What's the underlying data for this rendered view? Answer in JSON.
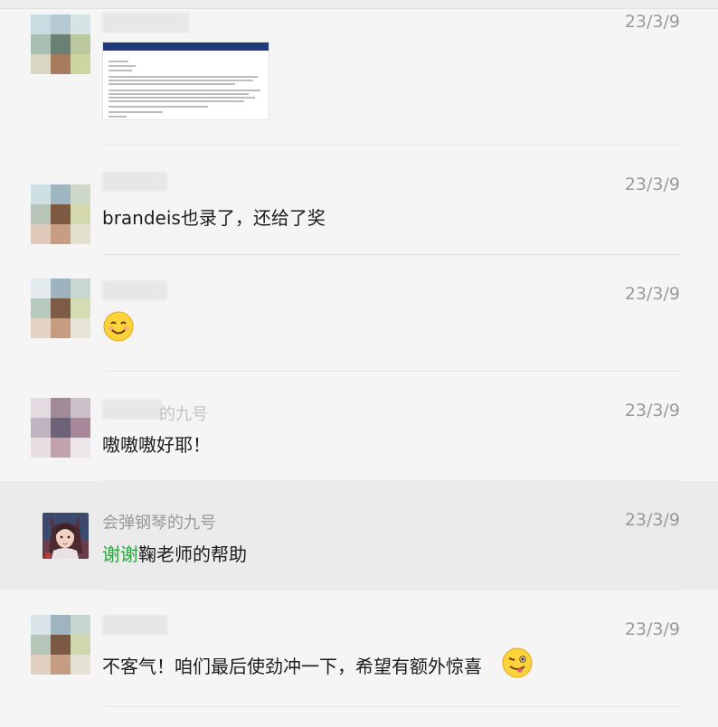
{
  "messages": [
    {
      "time": "23/3/9",
      "type": "image"
    },
    {
      "time": "23/3/9",
      "text": "brandeis也录了，还给了奖"
    },
    {
      "time": "23/3/9",
      "type": "emoji",
      "emoji": "smiling-face"
    },
    {
      "time": "23/3/9",
      "partial_name": "的九号",
      "text": "嗷嗷嗷好耶！"
    },
    {
      "time": "23/3/9",
      "name": "会弹钢琴的九号",
      "mention": "谢谢",
      "text": "鞠老师的帮助"
    },
    {
      "time": "23/3/9",
      "text": "不客气！咱们最后使劲冲一下，希望有额外惊喜",
      "emoji": "winking-tongue-face"
    }
  ],
  "colors": {
    "background": "#f5f5f5",
    "highlight": "#ebebeb",
    "mention": "#2ea043"
  }
}
